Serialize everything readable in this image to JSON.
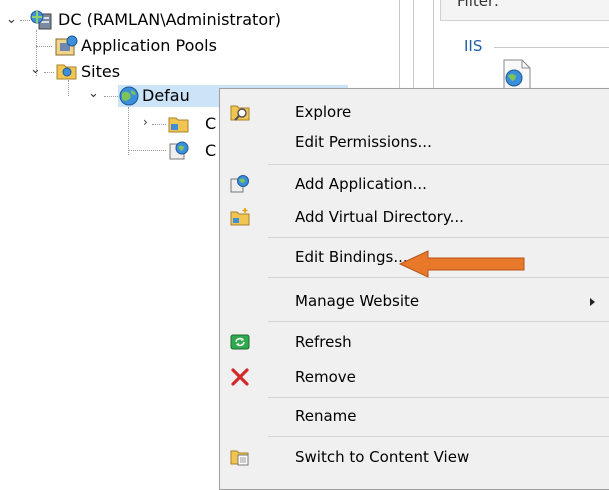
{
  "tree": {
    "server": "DC (RAMLAN\\Administrator)",
    "app_pools": "Application Pools",
    "sites": "Sites",
    "default_site": "Defau",
    "child1": "C",
    "child2": "C"
  },
  "right_pane": {
    "filter_label": "Filter:",
    "group_label": "IIS"
  },
  "context_menu": {
    "items": [
      {
        "label": "Explore",
        "icon": "explore-folder-icon"
      },
      {
        "label": "Edit Permissions...",
        "icon": ""
      },
      {
        "label": "Add Application...",
        "icon": "add-application-icon"
      },
      {
        "label": "Add Virtual Directory...",
        "icon": "add-virtual-directory-icon"
      },
      {
        "label": "Edit Bindings...",
        "icon": ""
      },
      {
        "label": "Manage Website",
        "icon": "",
        "submenu": true
      },
      {
        "label": "Refresh",
        "icon": "refresh-icon"
      },
      {
        "label": "Remove",
        "icon": "remove-x-icon"
      },
      {
        "label": "Rename",
        "icon": ""
      },
      {
        "label": "Switch to Content View",
        "icon": "content-view-icon"
      }
    ]
  },
  "annotation": {
    "arrow_color": "#e8782a"
  }
}
